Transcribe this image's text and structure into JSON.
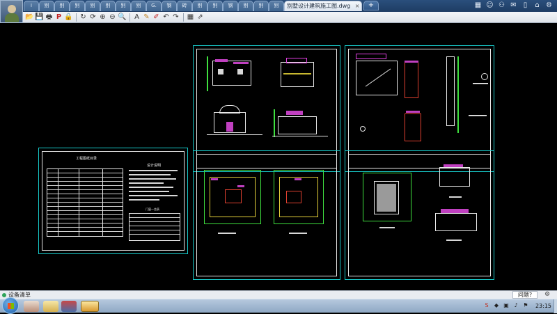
{
  "window": {
    "active_tab_title": "别墅设计建筑施工图.dwg",
    "active_tab_close": "×",
    "new_tab_label": "+",
    "tabs": [
      "i",
      "别",
      "别",
      "别",
      "别",
      "别",
      "别",
      "别",
      "G.",
      "钢",
      "砖",
      "别",
      "别",
      "钢",
      "别",
      "别",
      "别"
    ]
  },
  "top_right_icons": [
    "grid-icon",
    "user-icon",
    "user-add-icon",
    "chat-icon",
    "phone-icon",
    "mail-icon",
    "gear-icon"
  ],
  "toolbar_icons": [
    "open-folder-icon",
    "save-icon",
    "print-icon",
    "pdf-icon",
    "lock-icon",
    "rotate-icon",
    "refresh-icon",
    "zoom-in-icon",
    "zoom-out-icon",
    "zoom-window-icon",
    "text-icon",
    "pen-icon",
    "highlighter-icon",
    "undo-icon",
    "redo-icon",
    "layers-icon",
    "export-icon"
  ],
  "toolbar_glyphs": [
    "📂",
    "💾",
    "🖶",
    "P",
    "🔒",
    "↻",
    "⟳",
    "⊕",
    "⊖",
    "🔍",
    "A",
    "✎",
    "✐",
    "↶",
    "↷",
    "▦",
    "⇗"
  ],
  "drawing": {
    "sheet_titles": {
      "index_sheet": "工程图纸目录",
      "notes_sheet": "设计说明",
      "notes_sub": "门窗一览表"
    }
  },
  "status": {
    "text": "设备清单",
    "feedback_label": "问题?",
    "settings_glyph": "⚙"
  },
  "taskbar": {
    "clock": "23:15",
    "tray_icons": [
      "ime-icon",
      "shield-icon",
      "network-icon",
      "volume-icon",
      "flag-icon"
    ],
    "tray_glyphs": [
      "S",
      "◆",
      "▣",
      "♪",
      "⚑"
    ]
  },
  "colors": {
    "sheet_border": "#17c8c8",
    "canvas_bg": "#000000",
    "wall_green": "#3fe03f",
    "accent_magenta": "#e040e0"
  }
}
